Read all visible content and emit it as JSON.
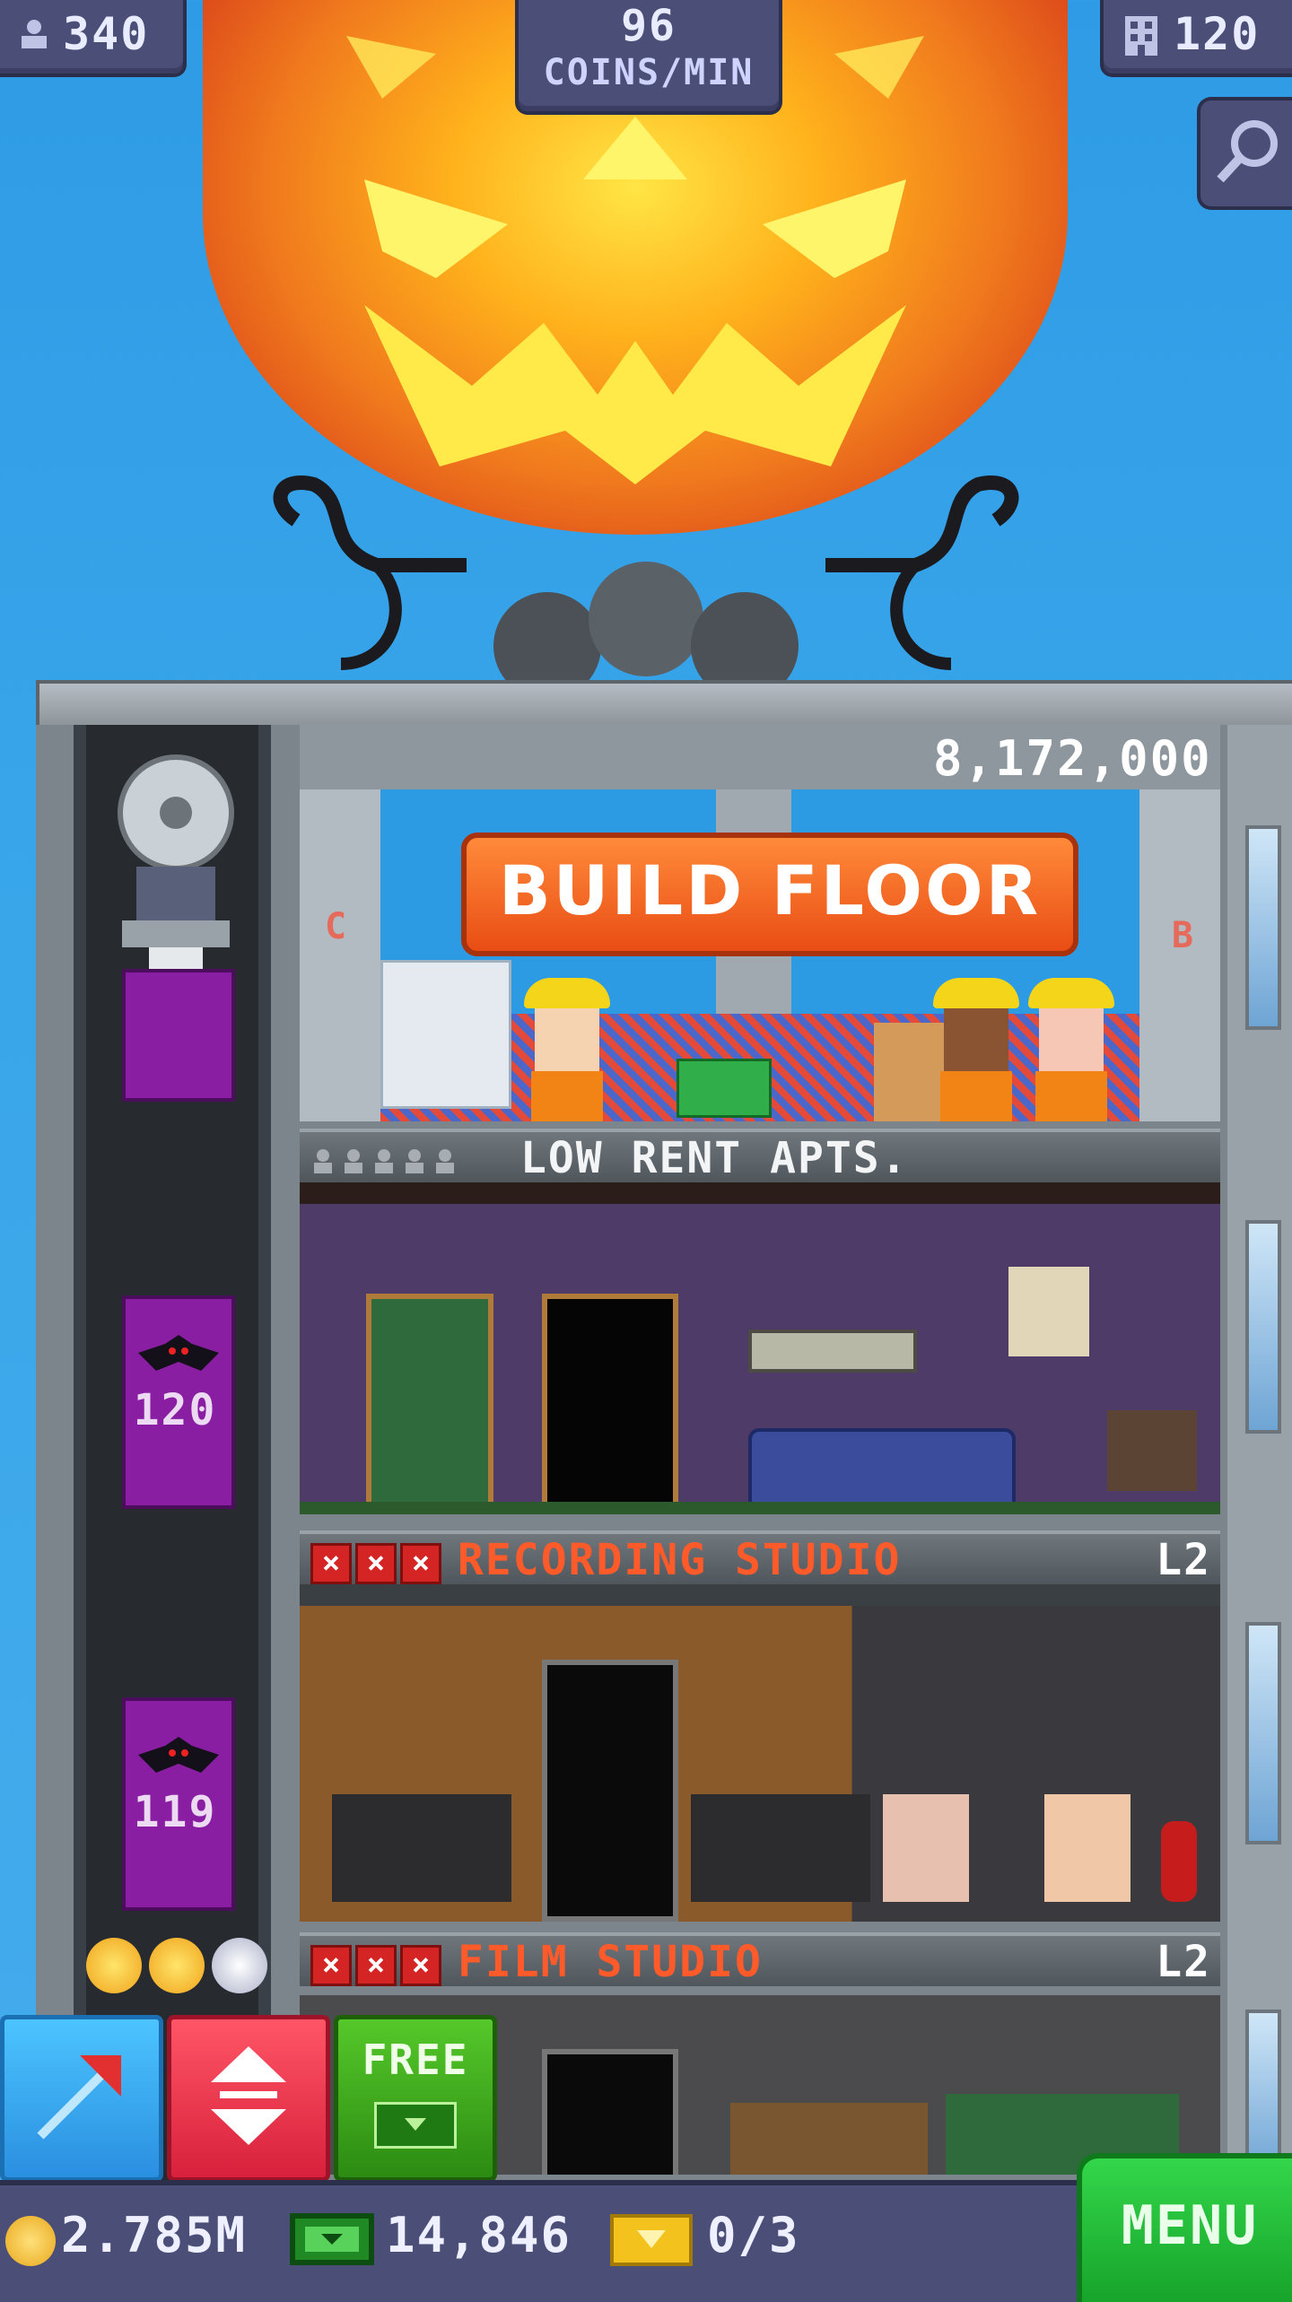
{
  "hud": {
    "population": "340",
    "coins_per_min_value": "96",
    "coins_per_min_label": "COINS/MIN",
    "floors": "120"
  },
  "build": {
    "cost": "8,172,000",
    "button_label": "BUILD FLOOR",
    "left_letter": "C",
    "right_letter": "B"
  },
  "floors": [
    {
      "name": "LOW RENT APTS.",
      "level": ""
    },
    {
      "name": "RECORDING STUDIO",
      "level": "L2"
    },
    {
      "name": "FILM STUDIO",
      "level": "L2"
    }
  ],
  "elevator": {
    "car_labels": [
      "120",
      "119"
    ]
  },
  "actions": {
    "free_label": "FREE"
  },
  "bottom": {
    "coins": "2.785M",
    "bux": "14,846",
    "tickets": "0/3",
    "menu_label": "MENU"
  },
  "colors": {
    "sky": "#39a6ea",
    "hud": "#4b4f78",
    "build_button": "#e94d14",
    "floor_label_red": "#ff5a2a",
    "menu_green": "#22b836"
  }
}
